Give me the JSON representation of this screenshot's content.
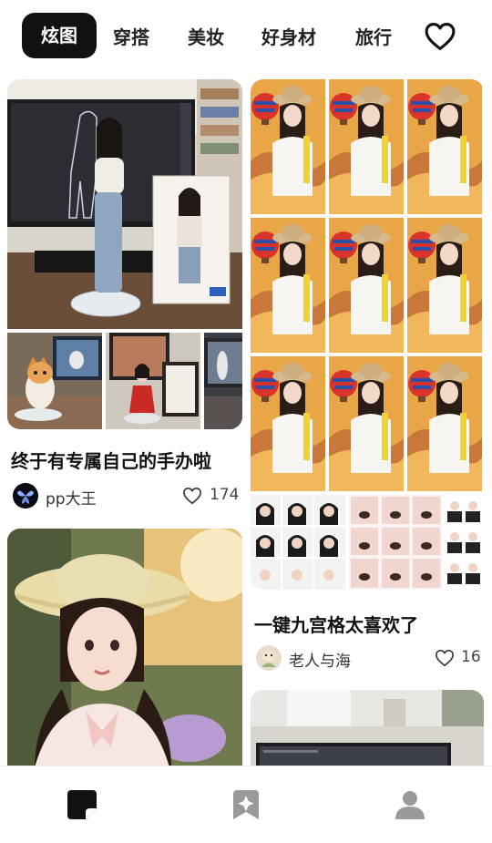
{
  "tabs": [
    "炫图",
    "穿搭",
    "美妆",
    "好身材",
    "旅行"
  ],
  "favorites_icon": "heart-outline-icon",
  "posts": [
    {
      "title": "终于有专属自己的手办啦",
      "author": "pp大王",
      "likes": "174"
    },
    {
      "title": "一键九宫格太喜欢了",
      "author": "老人与海",
      "likes": "16"
    }
  ],
  "bottom_nav": {
    "items": [
      {
        "icon": "note-icon",
        "active": true
      },
      {
        "icon": "sparkle-box-icon",
        "active": false
      },
      {
        "icon": "profile-icon",
        "active": false
      }
    ]
  },
  "colors": {
    "active_tab_bg": "#111111",
    "active_tab_text": "#ffffff",
    "nav_active": "#111111",
    "nav_inactive": "#9a9a9a"
  }
}
